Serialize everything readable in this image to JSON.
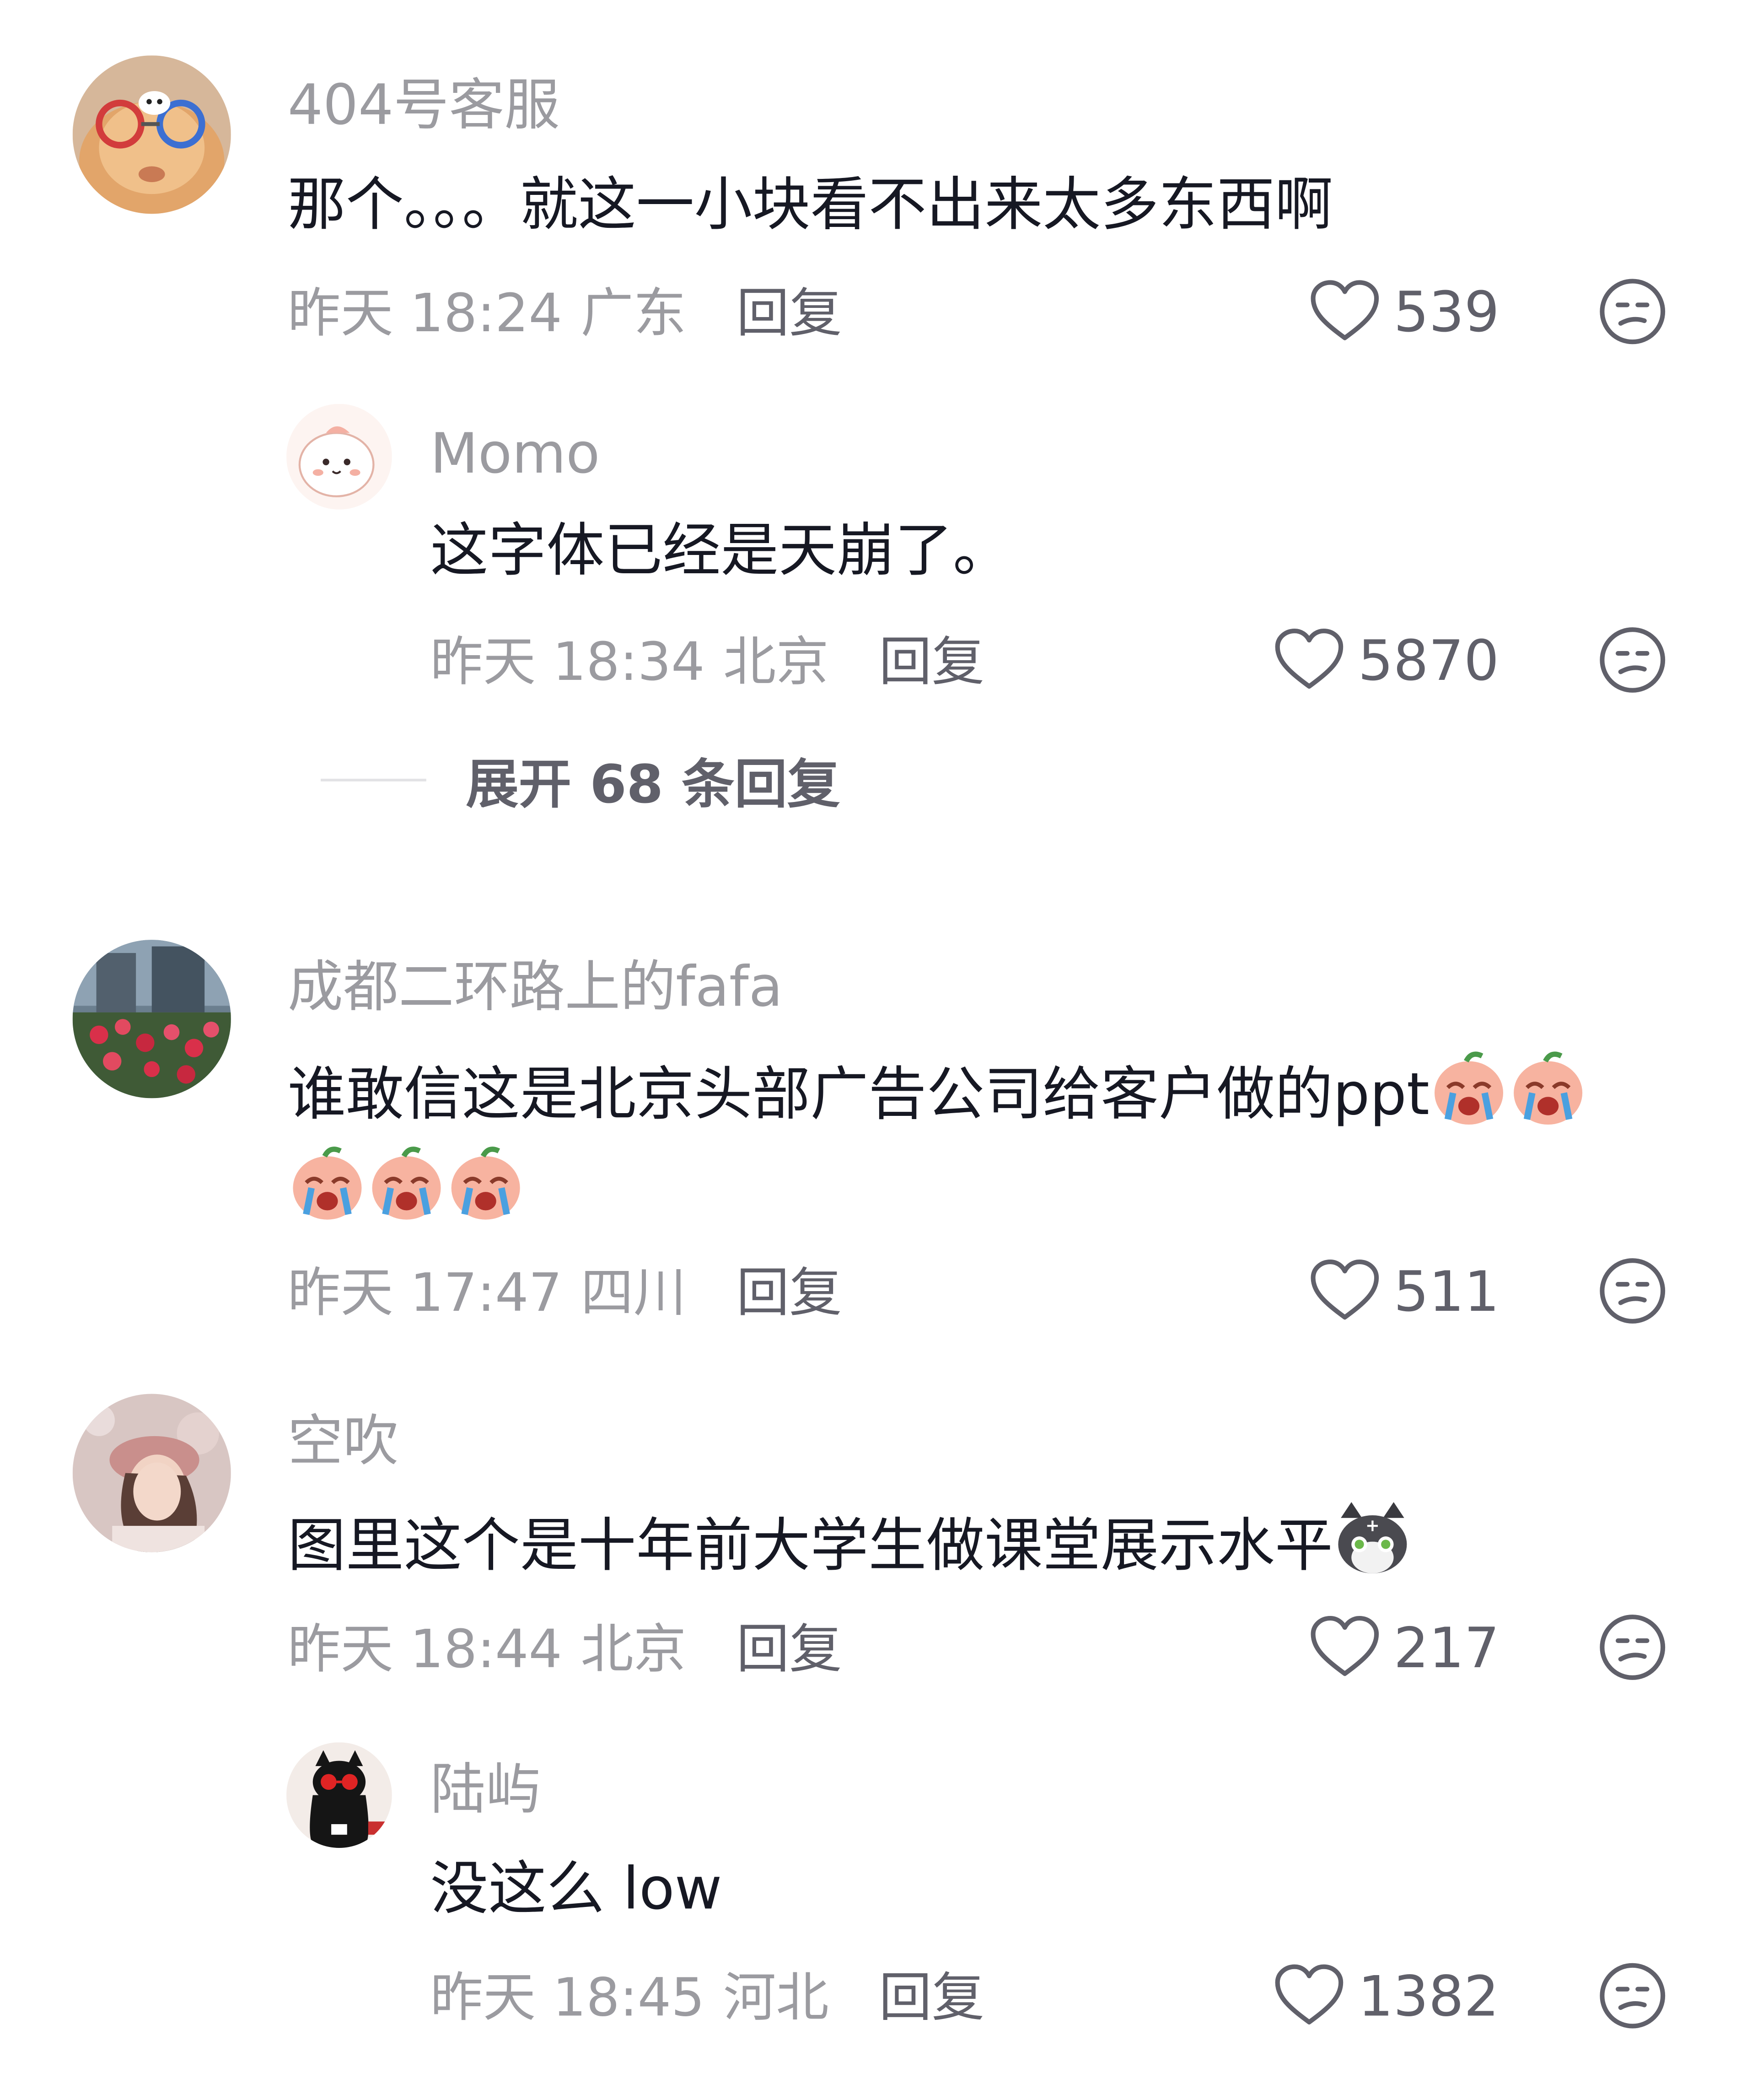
{
  "comments": [
    {
      "username": "404号客服",
      "text": "那个。。。就这一小块看不出来太多东西啊",
      "time": "昨天 18:24",
      "region": "广东",
      "reply_label": "回复",
      "likes": "539",
      "replies": [
        {
          "username": "Momo",
          "text": "这字体已经是天崩了。",
          "time": "昨天 18:34",
          "region": "北京",
          "reply_label": "回复",
          "likes": "5870"
        }
      ],
      "expand_label": "展开 68 条回复"
    },
    {
      "username": "成都二环路上的fafa",
      "text": "谁敢信这是北京头部广告公司给客户做的ppt",
      "emojis": [
        "crying-peach-emoji",
        "crying-peach-emoji",
        "crying-peach-emoji",
        "crying-peach-emoji",
        "crying-peach-emoji"
      ],
      "time": "昨天 17:47",
      "region": "四川",
      "reply_label": "回复",
      "likes": "511"
    },
    {
      "username": "空吹",
      "text": "图里这个是十年前大学生做课堂展示水平",
      "emojis": [
        "gray-cat-emoji"
      ],
      "time": "昨天 18:44",
      "region": "北京",
      "reply_label": "回复",
      "likes": "217",
      "replies": [
        {
          "username": "陆屿",
          "text": "没这么 low",
          "time": "昨天 18:45",
          "region": "河北",
          "reply_label": "回复",
          "likes": "1382"
        }
      ]
    }
  ],
  "icons": {
    "like": "heart-outline-icon",
    "dislike": "neutral-face-icon"
  },
  "colors": {
    "username": "#9b9ba0",
    "content": "#161823",
    "secondary": "#60606a"
  }
}
